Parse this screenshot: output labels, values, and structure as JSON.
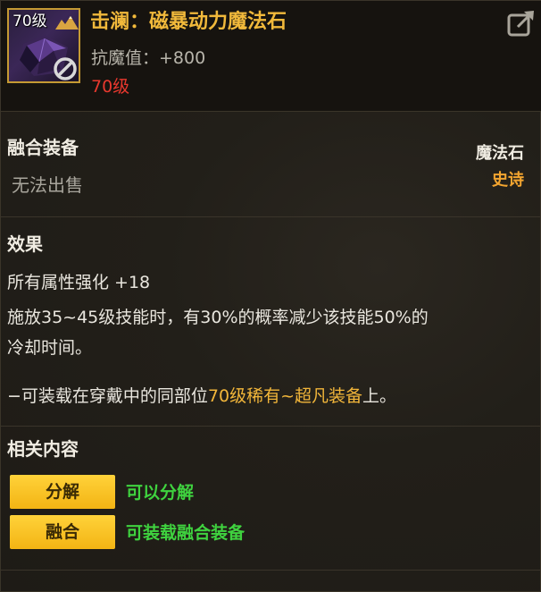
{
  "header": {
    "icon_level": "70级",
    "title": "击澜：磁暴动力魔法石",
    "resist_label": "抗魔值：",
    "resist_value": "+800",
    "level": "70级"
  },
  "info": {
    "category": "融合装备",
    "sell_status": "无法出售",
    "item_type": "魔法石",
    "rarity": "史诗"
  },
  "effect": {
    "heading": "效果",
    "line1": "所有属性强化 +18",
    "line2": "施放35~45级技能时，有30%的概率减少该技能50%的",
    "line3": "冷却时间。",
    "line4_prefix": "−可装载在穿戴中的同部位",
    "line4_highlight": "70级稀有~超凡装备",
    "line4_suffix": "上。"
  },
  "related": {
    "heading": "相关内容",
    "actions": [
      {
        "button": "分解",
        "desc": "可以分解"
      },
      {
        "button": "融合",
        "desc": "可装载融合装备"
      }
    ]
  },
  "colors": {
    "title": "#f1b93b",
    "level_red": "#e8382e",
    "rarity_orange": "#f3a530",
    "button_yellow": "#ffd23a",
    "desc_green": "#3fd33f"
  },
  "icons": [
    "mountain-icon",
    "gem-icon",
    "ban-icon",
    "share-icon"
  ]
}
